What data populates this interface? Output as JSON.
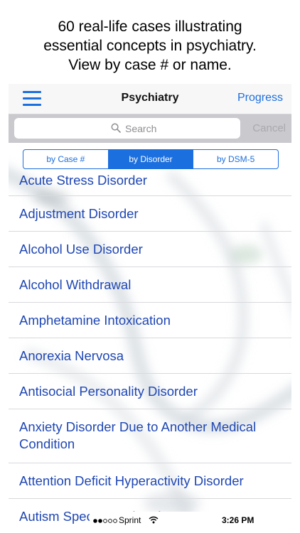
{
  "caption": {
    "line1": "60 real-life cases illustrating",
    "line2": "essential concepts in psychiatry.",
    "line3": "View by case # or name."
  },
  "navbar": {
    "title": "Psychiatry",
    "right_label": "Progress",
    "menu_icon": "hamburger-menu-icon"
  },
  "search": {
    "placeholder": "Search",
    "cancel_label": "Cancel",
    "icon": "search-icon"
  },
  "segments": [
    {
      "label": "by Case #",
      "selected": false
    },
    {
      "label": "by Disorder",
      "selected": true
    },
    {
      "label": "by DSM-5",
      "selected": false
    }
  ],
  "items": [
    "Acute Stress Disorder",
    "Adjustment Disorder",
    "Alcohol Use Disorder",
    "Alcohol Withdrawal",
    "Amphetamine Intoxication",
    "Anorexia Nervosa",
    "Antisocial Personality Disorder",
    "Anxiety Disorder Due to Another Medical Condition",
    "Attention Deficit Hyperactivity Disorder",
    "Autism Spectrum Disorder"
  ],
  "status_bar": {
    "carrier": "Sprint",
    "time": "3:26 PM",
    "signal_icon": "signal-dots-icon",
    "wifi_icon": "wifi-icon"
  },
  "colors": {
    "accent": "#1c6fde",
    "list_text": "#1f47b4"
  }
}
